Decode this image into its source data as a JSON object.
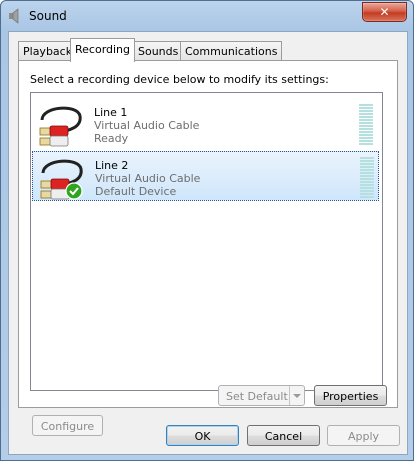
{
  "window": {
    "title": "Sound",
    "close_label": "✕"
  },
  "tabs": [
    {
      "label": "Playback"
    },
    {
      "label": "Recording"
    },
    {
      "label": "Sounds"
    },
    {
      "label": "Communications"
    }
  ],
  "instruction": "Select a recording device below to modify its settings:",
  "devices": [
    {
      "name": "Line 1",
      "description": "Virtual Audio Cable",
      "status": "Ready"
    },
    {
      "name": "Line 2",
      "description": "Virtual Audio Cable",
      "status": "Default Device"
    }
  ],
  "buttons": {
    "configure": "Configure",
    "set_default": "Set Default",
    "properties": "Properties",
    "ok": "OK",
    "cancel": "Cancel",
    "apply": "Apply"
  },
  "colors": {
    "accent": "#3399ff",
    "default_check": "#2ea41f"
  }
}
